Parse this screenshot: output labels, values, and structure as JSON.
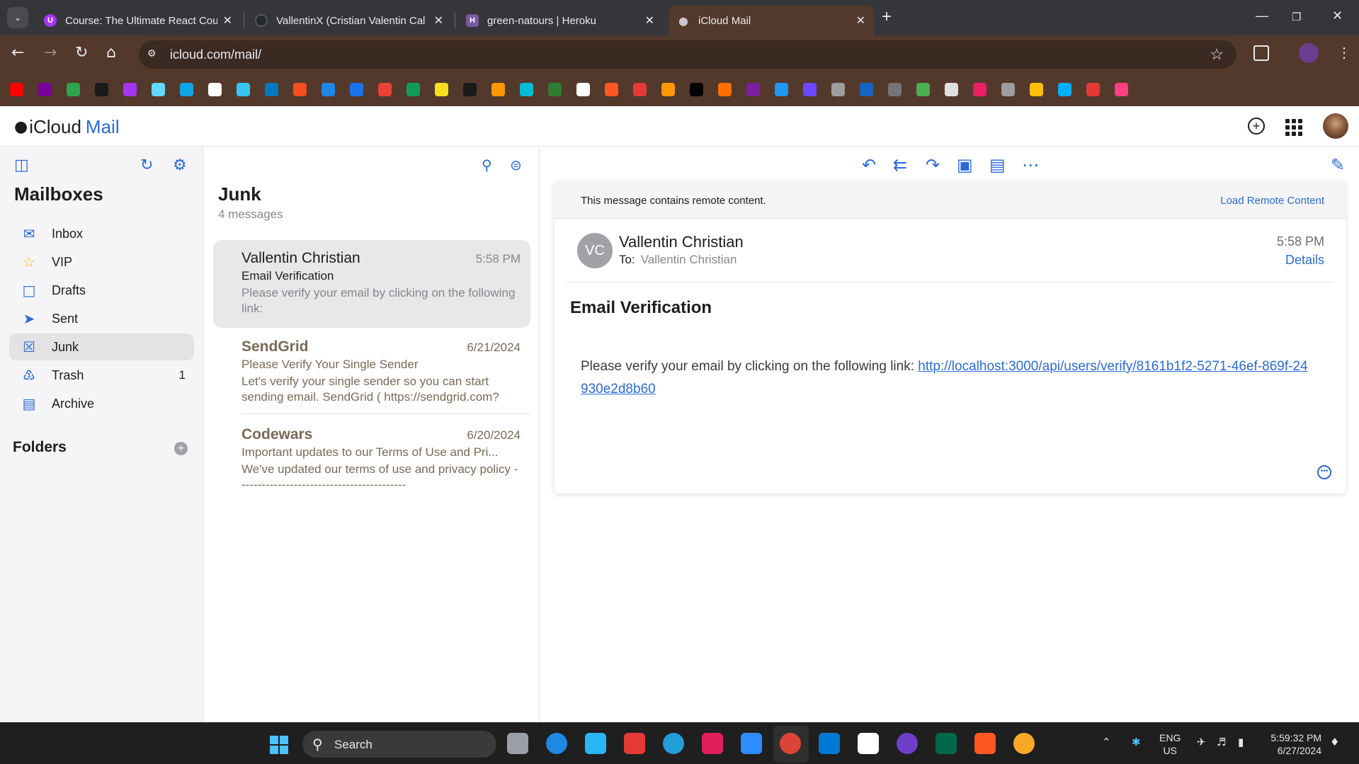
{
  "browser": {
    "tabs": [
      {
        "title": "Course: The Ultimate React Cou",
        "favicon_color": "#a435f0",
        "favicon_glyph": "U"
      },
      {
        "title": "VallentinX (Cristian Valentin Cal",
        "favicon_color": "#24292f",
        "favicon_glyph": ""
      },
      {
        "title": "green-natours | Heroku",
        "favicon_color": "#79589f",
        "favicon_glyph": "H"
      },
      {
        "title": "iCloud Mail",
        "favicon_color": "#8e8e93",
        "favicon_glyph": ""
      }
    ],
    "url": "icloud.com/mail/",
    "bookmark_colors": [
      "#ff0000",
      "#7b0099",
      "#2ea44f",
      "#1a1a1a",
      "#a435f0",
      "#61dafb",
      "#0ea5e9",
      "#ffffff",
      "#36c5f0",
      "#0079bf",
      "#f24e1e",
      "#1e88e5",
      "#1a73e8",
      "#ea4335",
      "#0f9d58",
      "#f7df1e",
      "#1a1a1a",
      "#ff9800",
      "#00bcd4",
      "#2e7d32",
      "#ffffff",
      "#ff5722",
      "#e53935",
      "#ff9800",
      "#000000",
      "#ff6f00",
      "#7b1fa2",
      "#2196f3",
      "#6c47ff",
      "#9e9e9e",
      "#1565c0",
      "#757575",
      "#4caf50",
      "#e0e0e0",
      "#e91e63",
      "#9e9e9e",
      "#ffc107",
      "#00b0ff",
      "#e53935",
      "#ff4081"
    ]
  },
  "app": {
    "logo_text": "iCloud",
    "logo_accent": "Mail",
    "accent_color": "#2a6bd8"
  },
  "sidebar": {
    "title": "Mailboxes",
    "items": [
      {
        "label": "Inbox",
        "icon": "inbox-icon",
        "glyph": "✉",
        "count": ""
      },
      {
        "label": "VIP",
        "icon": "star-icon",
        "glyph": "☆",
        "count": ""
      },
      {
        "label": "Drafts",
        "icon": "drafts-icon",
        "glyph": "□",
        "count": ""
      },
      {
        "label": "Sent",
        "icon": "sent-icon",
        "glyph": "➤",
        "count": ""
      },
      {
        "label": "Junk",
        "icon": "junk-icon",
        "glyph": "☒",
        "count": ""
      },
      {
        "label": "Trash",
        "icon": "trash-icon",
        "glyph": "♳",
        "count": "1"
      },
      {
        "label": "Archive",
        "icon": "archive-icon",
        "glyph": "▤",
        "count": ""
      }
    ],
    "folders_label": "Folders"
  },
  "list": {
    "title": "Junk",
    "subtitle": "4 messages",
    "messages": [
      {
        "from": "Vallentin Christian",
        "date": "5:58 PM",
        "subject": "Email Verification",
        "preview": "Please verify your email by clicking on the following link:"
      },
      {
        "from": "SendGrid",
        "date": "6/21/2024",
        "subject": "Please Verify Your Single Sender",
        "preview": "Let's verify your single sender so you can start sending email. SendGrid ( https://sendgrid.com?"
      },
      {
        "from": "Codewars",
        "date": "6/20/2024",
        "subject": "Important updates to our Terms of Use and Pri...",
        "preview": "We've updated our terms of use and privacy policy ------------------------------------------"
      }
    ]
  },
  "reader": {
    "remote_notice": "This message contains remote content.",
    "load_remote": "Load Remote Content",
    "avatar_initials": "VC",
    "sender": "Vallentin Christian",
    "to_label": "To:",
    "to_name": "Vallentin Christian",
    "time": "5:58 PM",
    "details": "Details",
    "subject": "Email Verification",
    "body_text": "Please verify your email by clicking on the following link: ",
    "link": "http://localhost:3000/api/users/verify/8161b1f2-5271-46ef-869f-24930e2d8b60"
  },
  "taskbar": {
    "search_label": "Search",
    "lang_line1": "ENG",
    "lang_line2": "US",
    "time": "5:59:32 PM",
    "date": "6/27/2024",
    "app_colors": [
      "#9aa0a6",
      "#1e88e5",
      "#29b6f6",
      "#e53935",
      "#229ed9",
      "#e01e5a",
      "#2d8cff",
      "#db4437",
      "#0078d4",
      "#ffffff",
      "#6e40c9",
      "#00684a",
      "#ff5722",
      "#f9a825"
    ]
  }
}
